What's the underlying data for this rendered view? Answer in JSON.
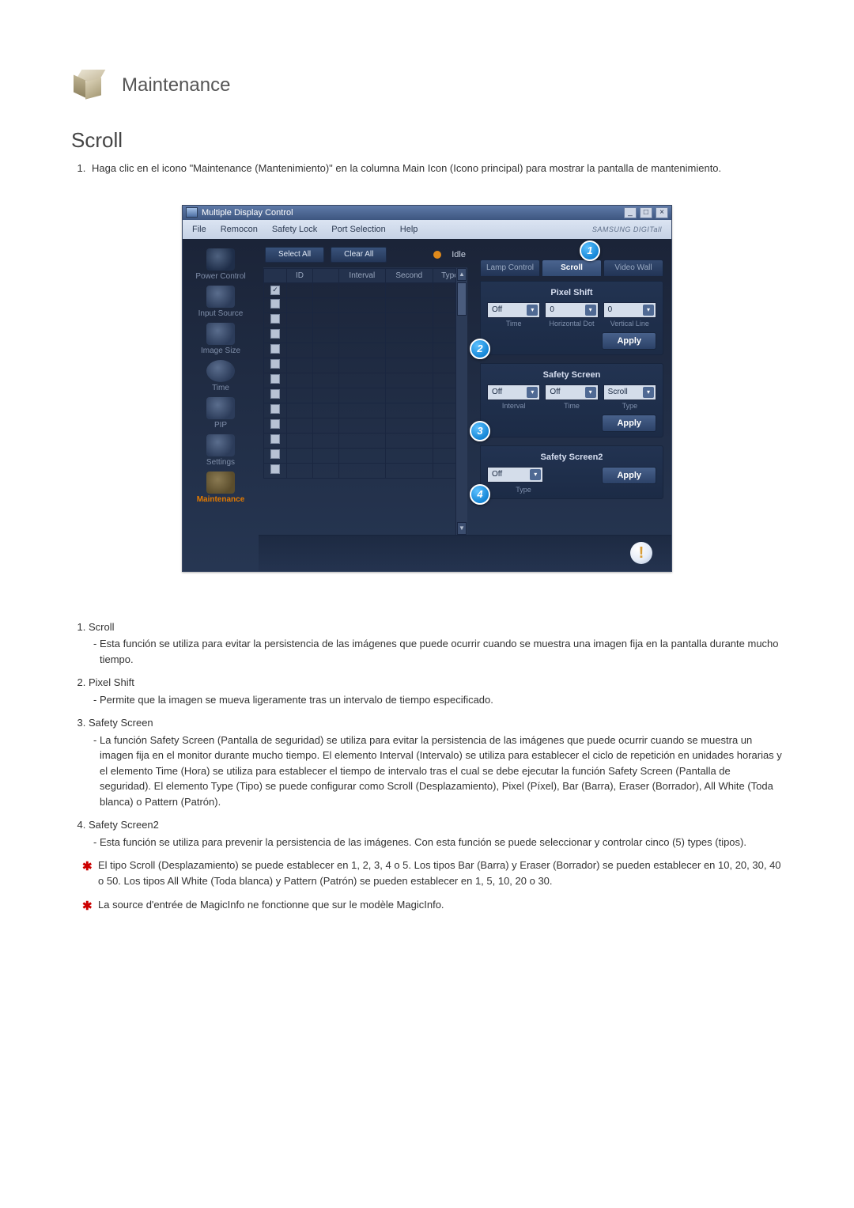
{
  "page": {
    "title": "Maintenance",
    "section": "Scroll",
    "intro": "Haga clic en el icono \"Maintenance (Mantenimiento)\" en la columna Main Icon (Icono principal) para mostrar la pantalla de mantenimiento."
  },
  "window": {
    "title": "Multiple Display Control",
    "win_min": "_",
    "win_max": "□",
    "win_close": "×",
    "menu": {
      "file": "File",
      "remocon": "Remocon",
      "safety_lock": "Safety Lock",
      "port_selection": "Port Selection",
      "help": "Help"
    },
    "brand": "SAMSUNG DIGITall"
  },
  "sidebar": {
    "items": [
      {
        "label": "Power Control"
      },
      {
        "label": "Input Source"
      },
      {
        "label": "Image Size"
      },
      {
        "label": "Time"
      },
      {
        "label": "PIP"
      },
      {
        "label": "Settings"
      },
      {
        "label": "Maintenance"
      }
    ]
  },
  "toolbar": {
    "select_all": "Select All",
    "clear_all": "Clear All",
    "idle": "Idle"
  },
  "grid": {
    "headers": {
      "id": "ID",
      "status": "",
      "interval": "Interval",
      "second": "Second",
      "type": "Type"
    }
  },
  "right": {
    "tabs": {
      "lamp": "Lamp Control",
      "scroll": "Scroll",
      "video_wall": "Video Wall"
    },
    "pixel_shift": {
      "title": "Pixel Shift",
      "time_val": "Off",
      "hdot_val": "0",
      "vline_val": "0",
      "time_label": "Time",
      "hdot_label": "Horizontal Dot",
      "vline_label": "Vertical Line",
      "apply": "Apply"
    },
    "safety_screen": {
      "title": "Safety Screen",
      "interval_val": "Off",
      "time_val": "Off",
      "type_val": "Scroll",
      "interval_label": "Interval",
      "time_label": "Time",
      "type_label": "Type",
      "apply": "Apply"
    },
    "safety_screen2": {
      "title": "Safety Screen2",
      "type_val": "Off",
      "type_label": "Type",
      "apply": "Apply"
    }
  },
  "callouts": {
    "c1": "1",
    "c2": "2",
    "c3": "3",
    "c4": "4"
  },
  "descriptions": {
    "i1_title": "Scroll",
    "i1_body": "Esta función se utiliza para evitar la persistencia de las imágenes que puede ocurrir cuando se muestra una imagen fija en la pantalla durante mucho tiempo.",
    "i2_title": "Pixel Shift",
    "i2_body": "Permite que la imagen se mueva ligeramente tras un intervalo de tiempo especificado.",
    "i3_title": "Safety Screen",
    "i3_body": "La función Safety Screen (Pantalla de seguridad) se utiliza para evitar la persistencia de las imágenes que puede ocurrir cuando se muestra un imagen fija en el monitor durante mucho tiempo. El elemento Interval (Intervalo) se utiliza para establecer el ciclo de repetición en unidades horarias y el elemento Time (Hora) se utiliza para establecer el tiempo de intervalo tras el cual se debe ejecutar la función Safety Screen (Pantalla de seguridad). El elemento Type (Tipo) se puede configurar como Scroll (Desplazamiento), Pixel (Píxel), Bar (Barra), Eraser (Borrador), All White (Toda blanca) o Pattern (Patrón).",
    "i4_title": "Safety Screen2",
    "i4_body": "Esta función se utiliza para prevenir la persistencia de las imágenes. Con esta función se puede seleccionar y controlar cinco (5) types (tipos).",
    "star1": "El tipo Scroll (Desplazamiento) se puede establecer en 1, 2, 3, 4 o 5. Los tipos Bar (Barra) y Eraser (Borrador) se pueden establecer en 10, 20, 30, 40 o 50. Los tipos All White (Toda blanca) y Pattern (Patrón) se pueden establecer en 1, 5, 10, 20 o 30.",
    "star2": "La source d'entrée de MagicInfo ne fonctionne que sur le modèle MagicInfo."
  }
}
